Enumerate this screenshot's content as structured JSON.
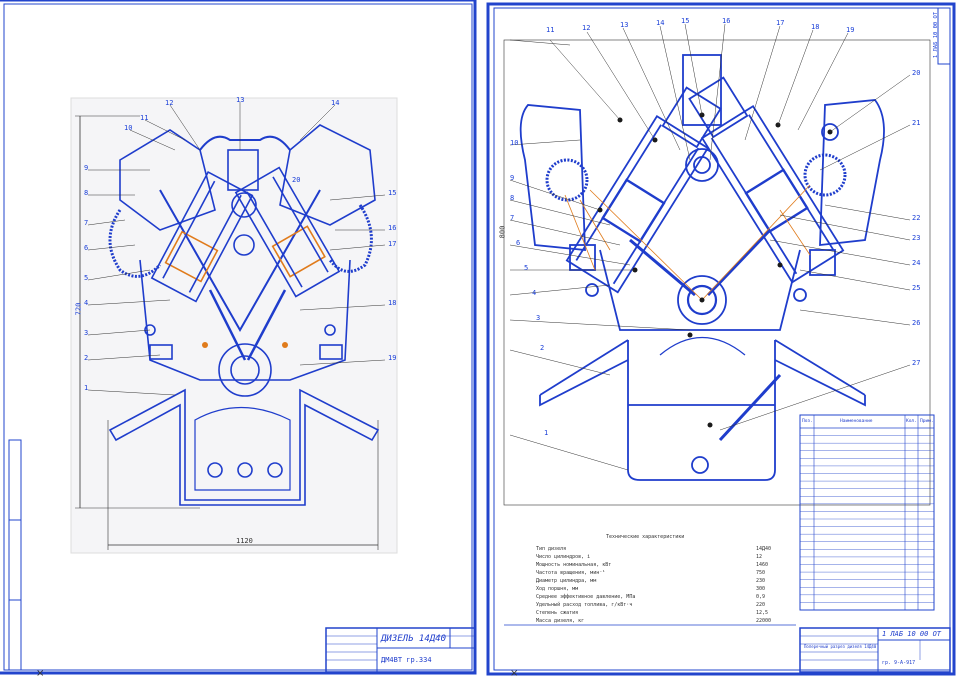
{
  "left_sheet": {
    "stamp": {
      "title": "ДИЗЕЛЬ 14Д40",
      "code": "ДМ4ВТ гр.334"
    },
    "dims": {
      "height": "720",
      "width": "1120"
    },
    "callouts": [
      "1",
      "2",
      "3",
      "4",
      "5",
      "6",
      "7",
      "8",
      "9",
      "10",
      "11",
      "12",
      "13",
      "14",
      "15",
      "16",
      "17",
      "18",
      "19",
      "20"
    ]
  },
  "right_sheet": {
    "side_label": "1 ЛАБ 10 00 ОТ",
    "dim_height": "800",
    "callouts_top": [
      "11",
      "12",
      "13",
      "14",
      "15",
      "16",
      "17",
      "18",
      "19"
    ],
    "callouts_left": [
      "10",
      "9",
      "8",
      "7",
      "6",
      "5",
      "4",
      "3",
      "2",
      "1"
    ],
    "callouts_right": [
      "20",
      "21",
      "22",
      "23",
      "24",
      "25",
      "26",
      "27"
    ],
    "spec_title": "Технические характеристики",
    "spec": [
      {
        "label": "Тип дизеля",
        "value": "14Д40"
      },
      {
        "label": "Число цилиндров, i",
        "value": "12"
      },
      {
        "label": "Мощность номинальная, кВт",
        "value": "1460"
      },
      {
        "label": "Частота вращения, мин⁻¹",
        "value": "750"
      },
      {
        "label": "Диаметр цилиндра, мм",
        "value": "230"
      },
      {
        "label": "Ход поршня, мм",
        "value": "300"
      },
      {
        "label": "Среднее эффективное давление, МПа",
        "value": "0,9"
      },
      {
        "label": "Удельный расход топлива, г/кВт·ч",
        "value": "220"
      },
      {
        "label": "Степень сжатия",
        "value": "12,5"
      },
      {
        "label": "Масса дизеля, кг",
        "value": "22000"
      }
    ],
    "bom_header": [
      "Поз.",
      "Наименование",
      "Кол.",
      "Прим."
    ],
    "bom_rows": 24,
    "stamp": {
      "title": "1 ЛАБ 10 00 ОТ",
      "subtitle": "Поперечный разрез дизеля 14Д40",
      "code": "гр. 9-А-917"
    }
  },
  "colors": {
    "line": "#1f3dcc",
    "accent": "#e07b1c",
    "frame": "#2244cc"
  }
}
